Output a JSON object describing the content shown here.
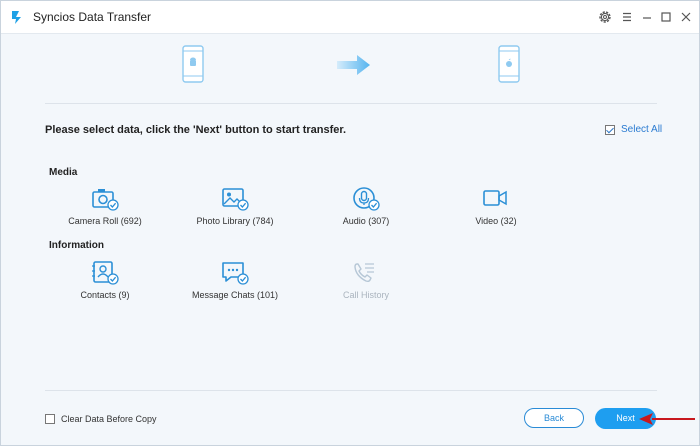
{
  "window": {
    "title": "Syncios Data Transfer",
    "logo_icon": "syncios-logo-icon",
    "controls": [
      "settings-icon",
      "menu-icon",
      "minimize-icon",
      "maximize-icon",
      "close-icon"
    ]
  },
  "devices": {
    "source_icon": "android-phone-icon",
    "arrow_icon": "transfer-arrow-icon",
    "target_icon": "iphone-icon"
  },
  "instruction": "Please select data, click the 'Next' button to start transfer.",
  "select_all": {
    "label": "Select All",
    "checked": true
  },
  "sections": {
    "media": {
      "title": "Media",
      "items": [
        {
          "label": "Camera Roll (692)",
          "icon": "camera-icon",
          "checked": true
        },
        {
          "label": "Photo Library (784)",
          "icon": "photo-icon",
          "checked": true
        },
        {
          "label": "Audio (307)",
          "icon": "microphone-icon",
          "checked": true
        },
        {
          "label": "Video (32)",
          "icon": "video-camera-icon",
          "checked": true
        }
      ]
    },
    "information": {
      "title": "Information",
      "items": [
        {
          "label": "Contacts (9)",
          "icon": "contacts-icon",
          "checked": true
        },
        {
          "label": "Message Chats (101)",
          "icon": "message-icon",
          "checked": true
        },
        {
          "label": "Call History",
          "icon": "call-history-icon",
          "checked": false,
          "disabled": true
        }
      ]
    }
  },
  "footer": {
    "clear_data_label": "Clear Data Before Copy",
    "clear_data_checked": false,
    "back_label": "Back",
    "next_label": "Next"
  },
  "colors": {
    "accent": "#1e9ef0",
    "icon_blue": "#2b8fd6",
    "disabled": "#b6c7d6",
    "background": "#f3f7fb",
    "annotation_arrow": "#c8181e"
  }
}
